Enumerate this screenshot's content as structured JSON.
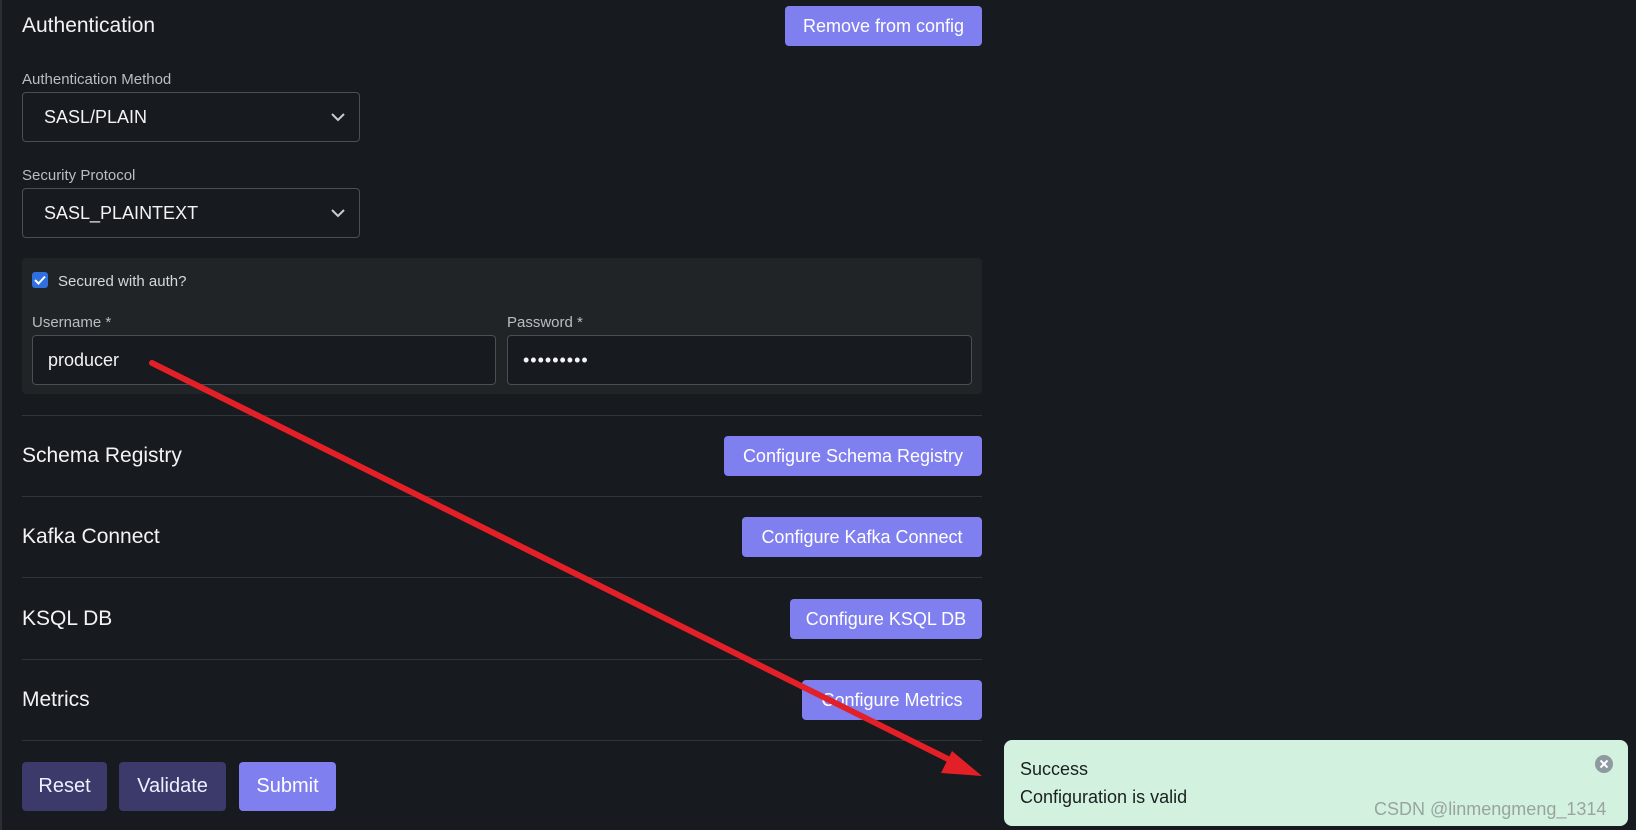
{
  "authentication": {
    "title": "Authentication",
    "remove_button": "Remove from config",
    "method_label": "Authentication Method",
    "method_value": "SASL/PLAIN",
    "protocol_label": "Security Protocol",
    "protocol_value": "SASL_PLAINTEXT",
    "secured_label": "Secured with auth?",
    "secured_checked": true,
    "username_label": "Username *",
    "username_value": "producer",
    "password_label": "Password *",
    "password_value": "•••••••••"
  },
  "sections": {
    "schema_registry": {
      "title": "Schema Registry",
      "button": "Configure Schema Registry"
    },
    "kafka_connect": {
      "title": "Kafka Connect",
      "button": "Configure Kafka Connect"
    },
    "ksql_db": {
      "title": "KSQL DB",
      "button": "Configure KSQL DB"
    },
    "metrics": {
      "title": "Metrics",
      "button": "Configure Metrics"
    }
  },
  "actions": {
    "reset": "Reset",
    "validate": "Validate",
    "submit": "Submit"
  },
  "toast": {
    "title": "Success",
    "message": "Configuration is valid"
  },
  "watermark": "CSDN @linmengmeng_1314",
  "colors": {
    "background": "#171a1e",
    "primary_button": "#7f7ff0",
    "dark_button": "#3b3a6a",
    "toast_background": "#d2f1de",
    "annotation_arrow": "#e32027"
  }
}
